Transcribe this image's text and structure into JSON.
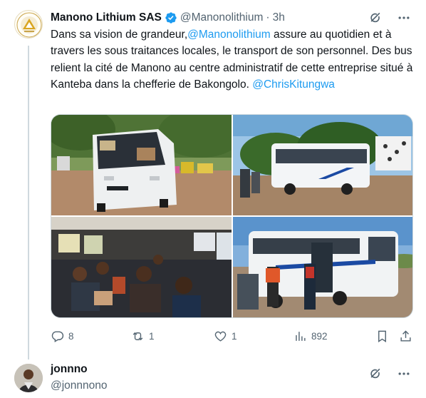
{
  "tweet": {
    "author_name": "Manono Lithium SAS",
    "handle": "@Manonolithium",
    "separator": "·",
    "time": "3h",
    "text_parts": {
      "p1": "Dans sa vision de grandeur,",
      "mention1": "@Manonolithium",
      "p2": " assure au quotidien et à travers les sous traitances locales, le transport de son personnel. Des bus relient la cité de Manono au centre administratif de cette entreprise situé à Kanteba dans la chefferie de Bakongolo. ",
      "mention2": "@ChrisKitungwa"
    },
    "photos": [
      {
        "icon": "bus-front-photo"
      },
      {
        "icon": "bus-side-photo"
      },
      {
        "icon": "bus-interior-photo"
      },
      {
        "icon": "bus-boarding-photo"
      }
    ],
    "stats": {
      "replies": "8",
      "reposts": "1",
      "likes": "1",
      "views": "892"
    }
  },
  "reply": {
    "author_name": "jonnno",
    "handle": "@jonnnono"
  },
  "colors": {
    "accent": "#1d9bf0",
    "muted": "#536471",
    "text": "#0f1419",
    "border": "#cfd9de"
  }
}
